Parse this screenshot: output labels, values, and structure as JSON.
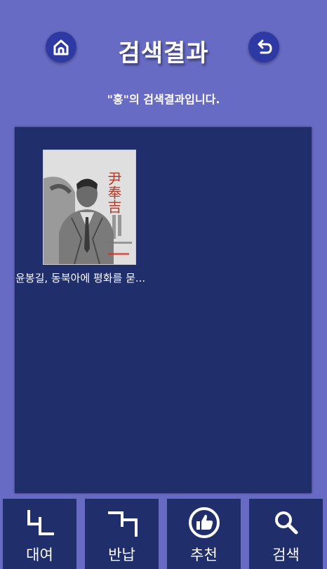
{
  "header": {
    "title": "검색결과",
    "home_icon": "home-icon",
    "back_icon": "return-arrow-icon"
  },
  "search": {
    "message": "\"홍\"의 검색결과입니다."
  },
  "results": [
    {
      "title": "윤봉길, 동북아에 평화를 묻...",
      "cover_text": "尹奉吉"
    }
  ],
  "nav": {
    "borrow_label": "대여",
    "return_label": "반납",
    "recommend_label": "추천",
    "search_label": "검색"
  },
  "colors": {
    "background": "#676bc3",
    "panel": "#202f6b",
    "button": "#2f39a3",
    "text": "#ffffff"
  }
}
